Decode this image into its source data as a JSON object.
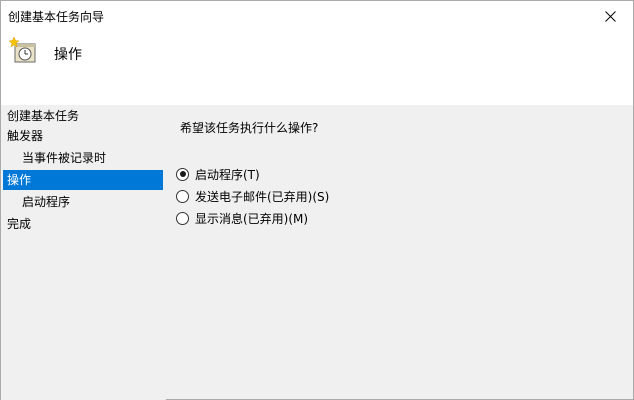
{
  "window": {
    "title": "创建基本任务向导"
  },
  "header": {
    "title": "操作",
    "icon": "scheduled-task-clock-icon"
  },
  "sidebar": {
    "items": [
      {
        "label": "创建基本任务",
        "level": 0,
        "selected": false
      },
      {
        "label": "触发器",
        "level": 0,
        "selected": false
      },
      {
        "label": "当事件被记录时",
        "level": 1,
        "selected": false
      },
      {
        "label": "操作",
        "level": 0,
        "selected": true
      },
      {
        "label": "启动程序",
        "level": 1,
        "selected": false
      },
      {
        "label": "完成",
        "level": 0,
        "selected": false
      }
    ]
  },
  "main": {
    "question": "希望该任务执行什么操作?",
    "options": [
      {
        "label": "启动程序(T)",
        "checked": true
      },
      {
        "label": "发送电子邮件(已弃用)(S)",
        "checked": false
      },
      {
        "label": "显示消息(已弃用)(M)",
        "checked": false
      }
    ]
  },
  "colors": {
    "selection": "#0078d7",
    "header_bg": "#ffffff",
    "body_bg": "#f0f0f0"
  }
}
